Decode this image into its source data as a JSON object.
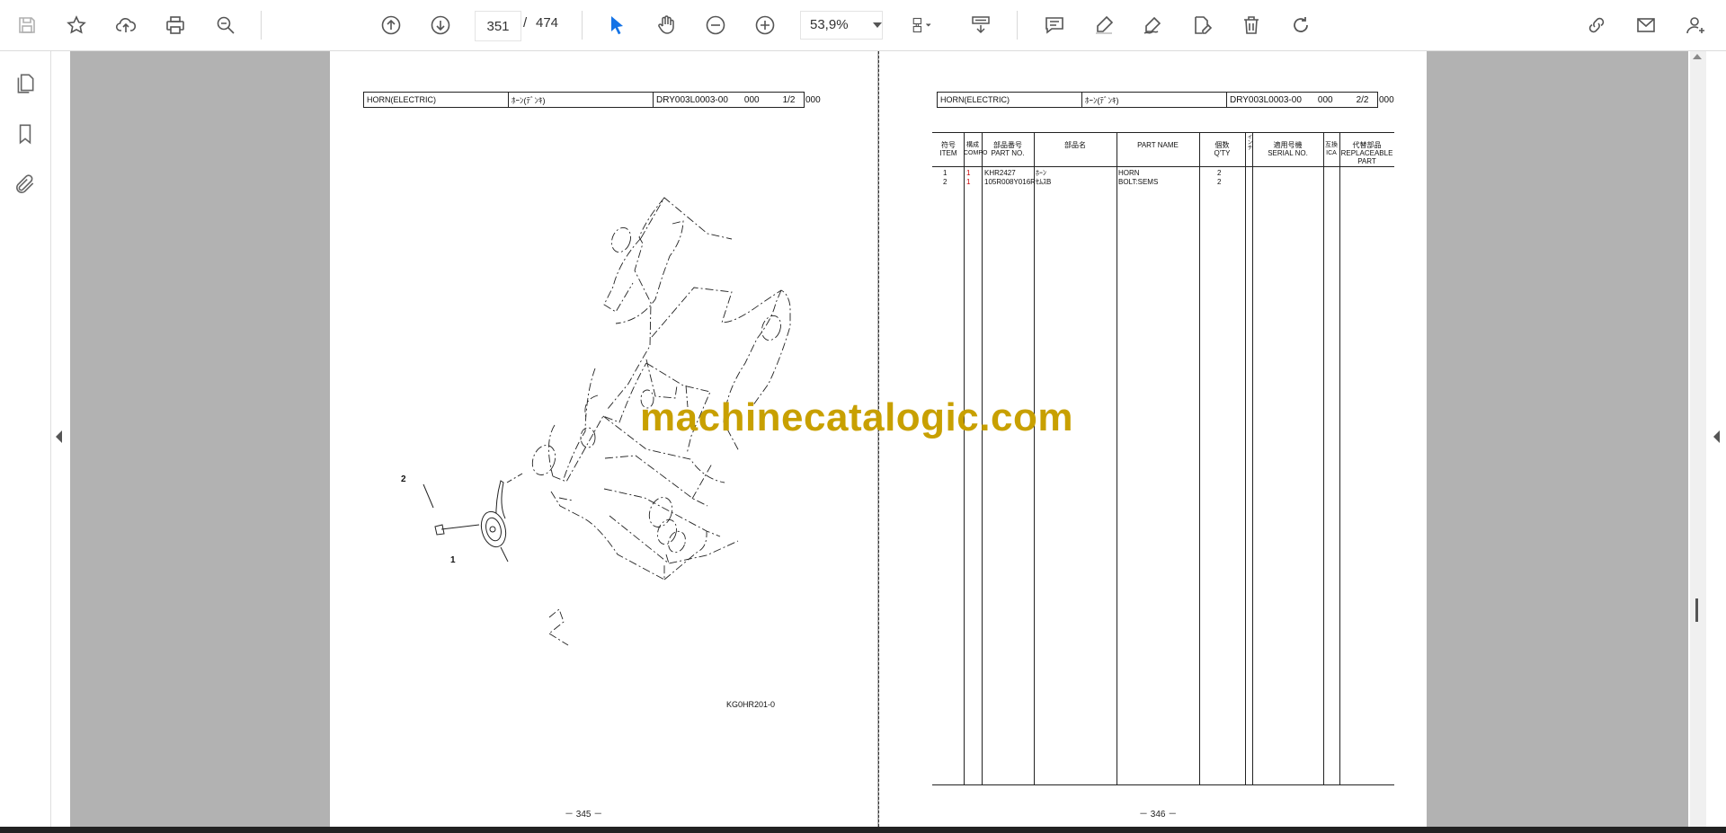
{
  "toolbar": {
    "left_icons": [
      "save-icon",
      "star-icon",
      "upload-icon",
      "print-icon",
      "find-icon"
    ],
    "prev_page_icon": "arrow-up-circle-icon",
    "next_page_icon": "arrow-down-circle-icon",
    "current_page": "351",
    "page_separator": "/",
    "total_pages": "474",
    "zoom_out_icon": "minus-circle-icon",
    "zoom_in_icon": "plus-circle-icon",
    "zoom_level": "53,9%",
    "right_icons": [
      "comment-icon",
      "highlight-icon",
      "sign-icon",
      "edit-pdf-icon",
      "delete-icon",
      "rotate-icon",
      "link-icon",
      "mail-icon",
      "account-icon"
    ]
  },
  "leftrail": {
    "icons": [
      "pages-icon",
      "bookmark-icon",
      "attachment-icon"
    ]
  },
  "left_page": {
    "header": {
      "name_en": "HORN(ELECTRIC)",
      "name_jp": "ﾎｰﾝ(ﾃﾞﾝｷ)",
      "code": "DRY003L0003-00",
      "rev": "000",
      "sheet": "1/2",
      "suffix": "000"
    },
    "callouts": [
      "2",
      "1"
    ],
    "diagram_code": "KG0HR201-0",
    "page_number": "－ 345 －"
  },
  "right_page": {
    "header": {
      "name_en": "HORN(ELECTRIC)",
      "name_jp": "ﾎｰﾝ(ﾃﾞﾝｷ)",
      "code": "DRY003L0003-00",
      "rev": "000",
      "sheet": "2/2",
      "suffix": "000"
    },
    "columns": [
      {
        "jp": "符号",
        "en": "ITEM"
      },
      {
        "jp": "構成",
        "en": "COMPO"
      },
      {
        "jp": "部品番号",
        "en": "PART NO."
      },
      {
        "jp": "部品名",
        "en": ""
      },
      {
        "jp": "",
        "en": "PART NAME"
      },
      {
        "jp": "個数",
        "en": "Q'TY"
      },
      {
        "jp": "インチ",
        "en": ""
      },
      {
        "jp": "適用号機",
        "en": "SERIAL NO."
      },
      {
        "jp": "互換",
        "en": "ICA"
      },
      {
        "jp": "代替部品",
        "en": "REPLACEABLE PART"
      }
    ],
    "rows": [
      {
        "item": "1",
        "compo": "1",
        "part_no": "KHR2427",
        "name_jp": "ﾎｰﾝ",
        "part_name": "HORN",
        "qty": "2"
      },
      {
        "item": "2",
        "compo": "1",
        "part_no": "105R008Y016R",
        "name_jp": "ｾﾑｽB",
        "part_name": "BOLT:SEMS",
        "qty": "2"
      }
    ],
    "page_number": "－ 346 －"
  },
  "watermark": "machinecatalogic.com",
  "colors": {
    "viewer_bg": "#b2b2b2",
    "accent": "#1473e6",
    "watermark": "#c8a000",
    "compo_red": "#cc0000"
  }
}
